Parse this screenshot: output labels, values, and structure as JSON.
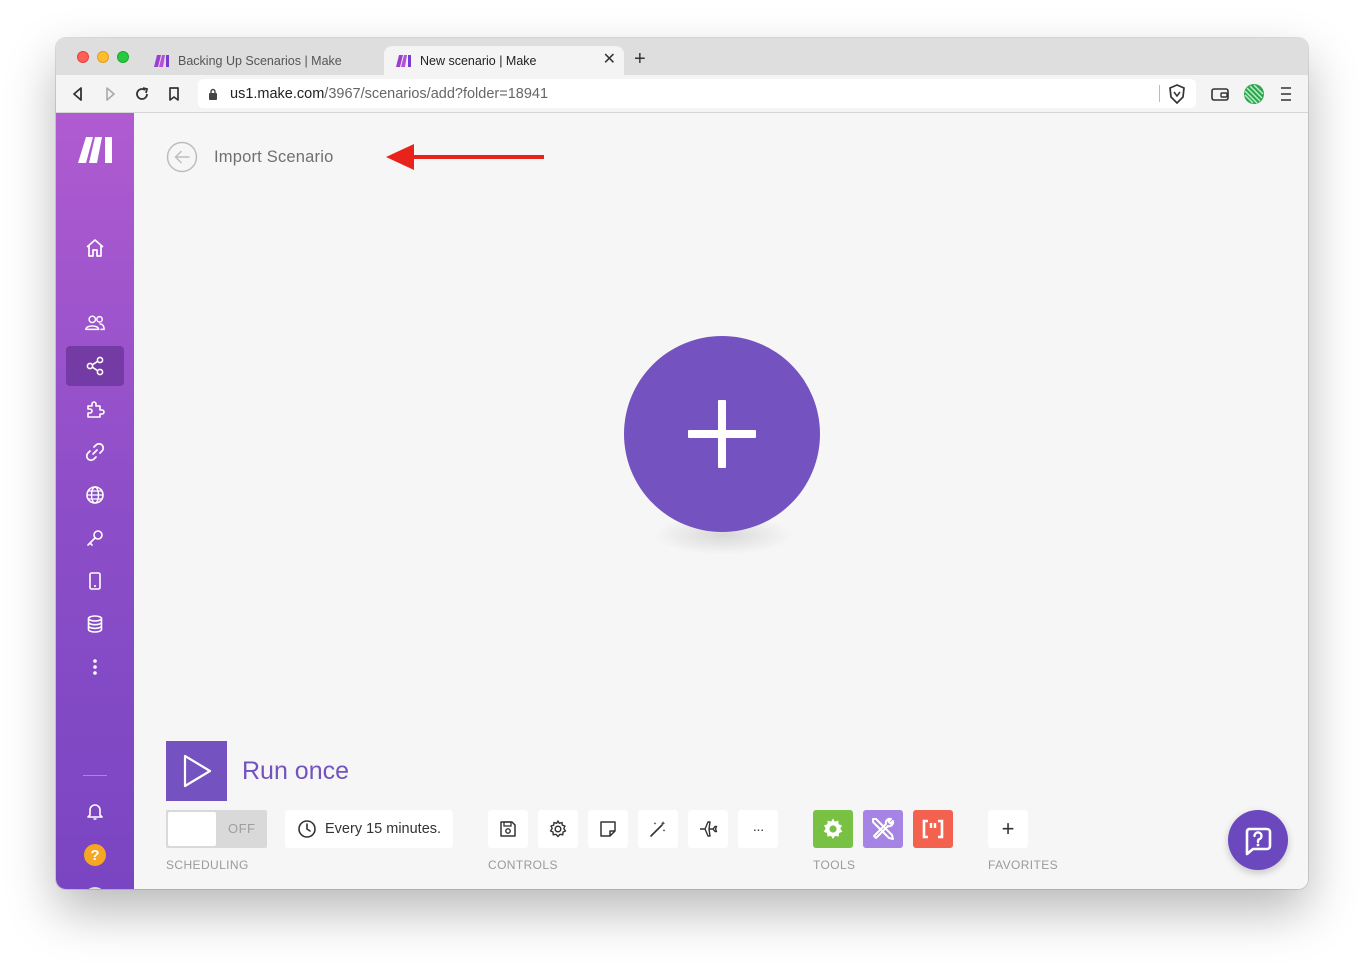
{
  "browser": {
    "tabs": [
      {
        "title": "Backing Up Scenarios | Make",
        "active": false
      },
      {
        "title": "New scenario | Make",
        "active": true
      }
    ],
    "new_tab_label": "+",
    "close_tab_label": "✕",
    "url_host": "us1.make.com",
    "url_path": "/3967/scenarios/add?folder=18941"
  },
  "sidebar": {
    "items": [
      {
        "name": "home",
        "icon": "home-icon"
      },
      {
        "name": "teams",
        "icon": "users-icon"
      },
      {
        "name": "scenarios",
        "icon": "share-icon",
        "active": true
      },
      {
        "name": "templates",
        "icon": "puzzle-icon"
      },
      {
        "name": "connections",
        "icon": "link-icon"
      },
      {
        "name": "webhooks",
        "icon": "globe-icon"
      },
      {
        "name": "keys",
        "icon": "key-icon"
      },
      {
        "name": "devices",
        "icon": "phone-icon"
      },
      {
        "name": "data-stores",
        "icon": "database-icon"
      },
      {
        "name": "more",
        "icon": "more-vertical-icon"
      }
    ],
    "bottom": [
      {
        "name": "notifications",
        "icon": "bell-icon"
      },
      {
        "name": "help",
        "icon": "help-icon",
        "label": "?"
      },
      {
        "name": "profile",
        "icon": "avatar-icon"
      }
    ]
  },
  "header": {
    "import_label": "Import Scenario"
  },
  "run": {
    "label": "Run once"
  },
  "scheduling": {
    "toggle_state": "OFF",
    "interval": "Every 15 minutes.",
    "section_label": "SCHEDULING"
  },
  "controls": {
    "section_label": "CONTROLS",
    "more_label": "···",
    "items": [
      "save-icon",
      "settings-icon",
      "notes-icon",
      "auto-align-icon",
      "explain-flow-icon",
      "more-icon"
    ]
  },
  "tools": {
    "section_label": "TOOLS",
    "colors": {
      "tools_green": "#79c143",
      "flow_purple": "#a684e6",
      "text_red": "#f3614f"
    }
  },
  "favorites": {
    "section_label": "FAVORITES",
    "add_label": "+"
  },
  "colors": {
    "brand": "#7452bf",
    "annotation_arrow": "#e8231c"
  }
}
